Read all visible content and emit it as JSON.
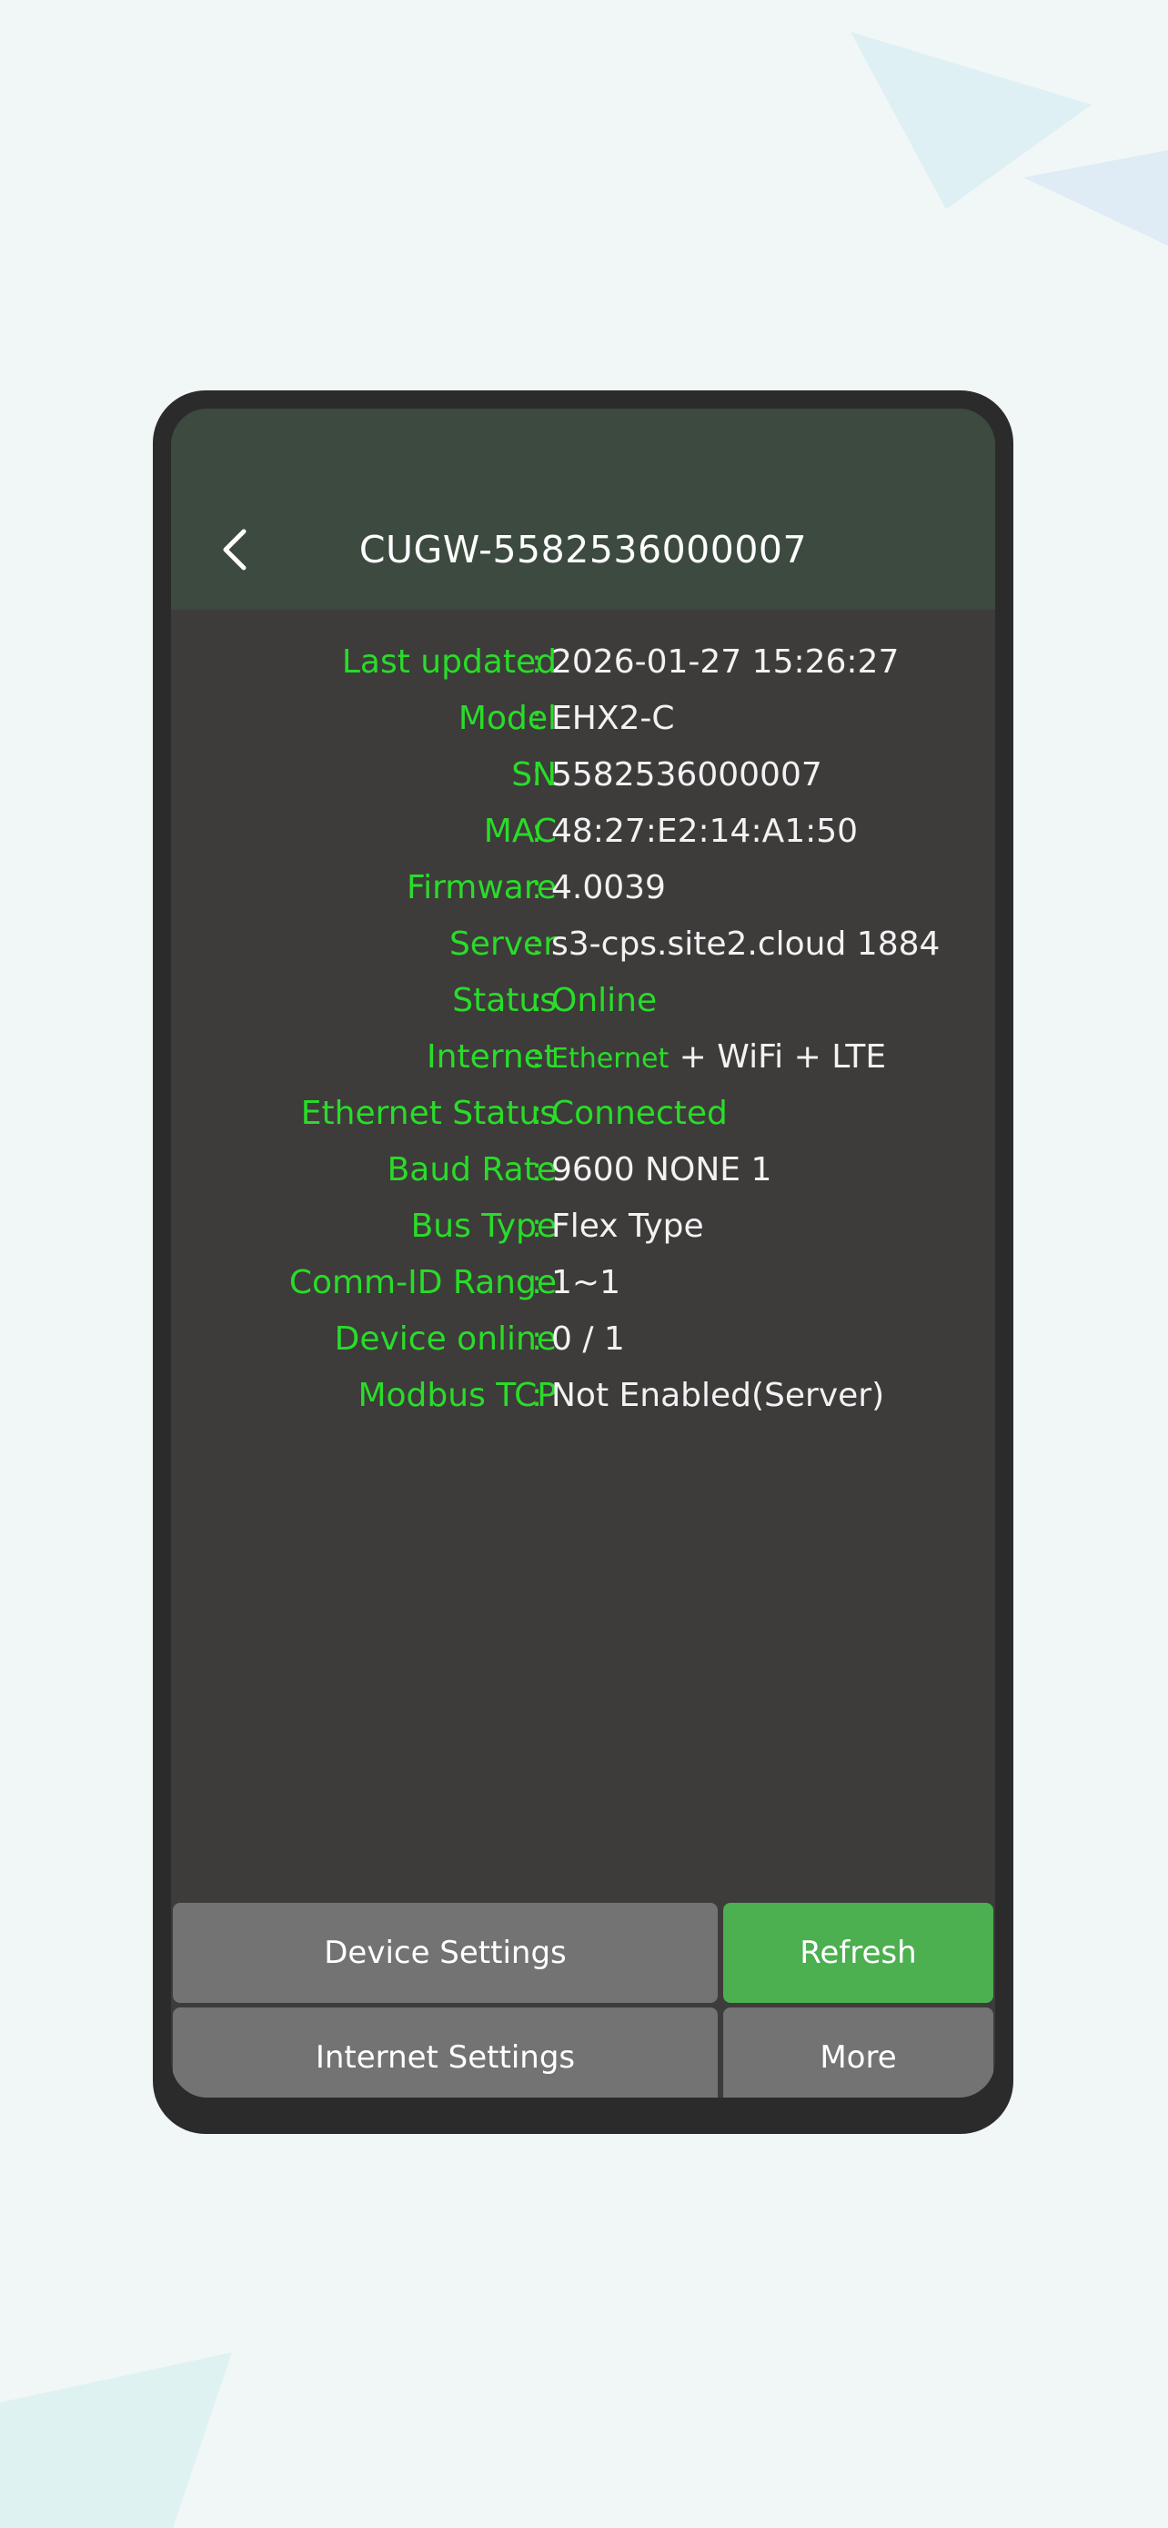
{
  "header": {
    "title": "CUGW-5582536000007"
  },
  "info": [
    {
      "label": "Last updated",
      "value": "2026-01-27 15:26:27"
    },
    {
      "label": "Model",
      "value": "EHX2-C"
    },
    {
      "label": "SN",
      "value": "5582536000007"
    },
    {
      "label": "MAC",
      "value": "48:27:E2:14:A1:50"
    },
    {
      "label": "Firmware",
      "value": "4.0039"
    },
    {
      "label": "Server",
      "value": "s3-cps.site2.cloud 1884"
    },
    {
      "label": "Status",
      "value": "Online"
    },
    {
      "label": "Internet",
      "value_ethernet": "Ethernet",
      "value_rest": " + WiFi + LTE"
    },
    {
      "label": "Ethernet Status",
      "value": "Connected"
    },
    {
      "label": "Baud Rate",
      "value": "9600 NONE 1"
    },
    {
      "label": "Bus Type",
      "value": "Flex Type"
    },
    {
      "label": "Comm-ID Range",
      "value": "1~1"
    },
    {
      "label": "Device online",
      "value": "0 / 1"
    },
    {
      "label": "Modbus TCP",
      "value": "Not Enabled(Server)"
    }
  ],
  "colon": ":",
  "buttons": {
    "device_settings": "Device Settings",
    "refresh": "Refresh",
    "internet_settings": "Internet Settings",
    "more": "More"
  },
  "icons": {
    "back": "chevron-left-icon"
  },
  "colors": {
    "label_green": "#29dc29",
    "header_bg": "#3c4a3f",
    "screen_bg": "#3e3b3b",
    "refresh_bg": "#4caf50",
    "button_gray": "#737373"
  }
}
